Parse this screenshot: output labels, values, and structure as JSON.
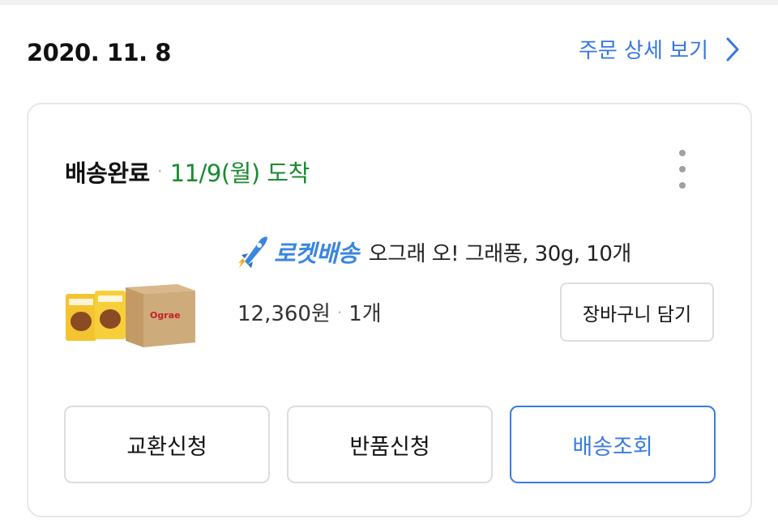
{
  "order": {
    "date": "2020. 11. 8",
    "detail_link": "주문 상세 보기"
  },
  "status": {
    "label": "배송완료",
    "separator": "·",
    "arrival": "11/9(월) 도착"
  },
  "product": {
    "badge": "로켓배송",
    "name": "오그래 오! 그래퐁, 30g, 10개",
    "price": "12,360원",
    "separator": "·",
    "quantity": "1개",
    "image_text": "Ograe"
  },
  "buttons": {
    "cart": "장바구니 담기",
    "exchange": "교환신청",
    "return": "반품신청",
    "track": "배송조회"
  },
  "colors": {
    "accent": "#3477e0",
    "arrival_green": "#1a8a30",
    "rocket_blue": "#3a86e0"
  },
  "icons": {
    "detail_chevron": "chevron-right-icon",
    "more": "more-vertical-icon",
    "rocket": "rocket-icon"
  }
}
